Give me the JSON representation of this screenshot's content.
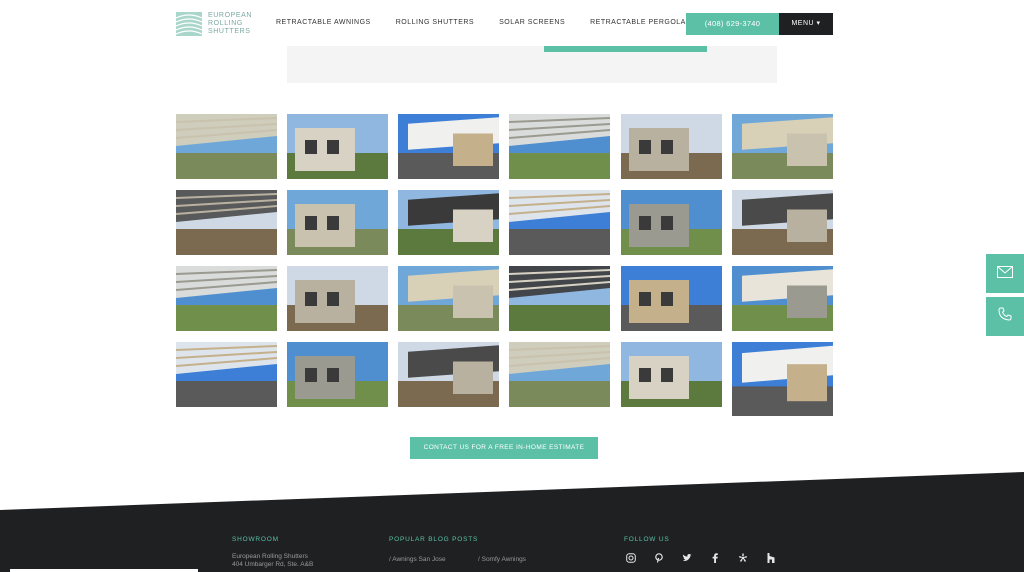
{
  "header": {
    "logo_lines": [
      "EUROPEAN",
      "ROLLING",
      "SHUTTERS"
    ],
    "nav": [
      "RETRACTABLE AWNINGS",
      "ROLLING SHUTTERS",
      "SOLAR SCREENS",
      "RETRACTABLE PERGOLA COVERS"
    ],
    "phone": "(408) 629-3740",
    "menu_label": "MENU ▾"
  },
  "gallery": {
    "rows": 4,
    "cols": 6,
    "items": [
      "awning-pool",
      "house-yard",
      "striped-awning-deck",
      "awning-patio-people",
      "awning-closeup-white",
      "awning-closeup-white-2",
      "awning-patio-wide",
      "house-awning-side",
      "house-back-awning",
      "awning-glass-view",
      "house-yard-side",
      "workers-under-awning",
      "people-under-red-awning",
      "patio-cover-yard",
      "house-pool-patio",
      "vendors-umbrella",
      "work-van",
      "workers-umbrella",
      "installers-ladders",
      "house-yellow-patio",
      "house-yellow-patio-2",
      "house-yellow-awning",
      "striped-awning-garden",
      "awning-closeup-white-3"
    ]
  },
  "cta": "CONTACT US FOR A FREE IN-HOME ESTIMATE",
  "side_buttons": [
    "email-icon",
    "phone-icon"
  ],
  "footer": {
    "showroom_title": "SHOWROOM",
    "showroom_lines": [
      "European Rolling Shutters",
      "404 Umbarger Rd, Ste. A&B"
    ],
    "blog_title": "POPULAR BLOG POSTS",
    "blog_links": [
      "/  Awnings San Jose",
      "/  Somfy Awnings"
    ],
    "follow_title": "FOLLOW US",
    "social": [
      "instagram-icon",
      "pinterest-icon",
      "twitter-icon",
      "facebook-icon",
      "yelp-icon",
      "houzz-icon"
    ]
  },
  "colors": {
    "accent": "#5cc0a7",
    "dark": "#1f2022"
  }
}
